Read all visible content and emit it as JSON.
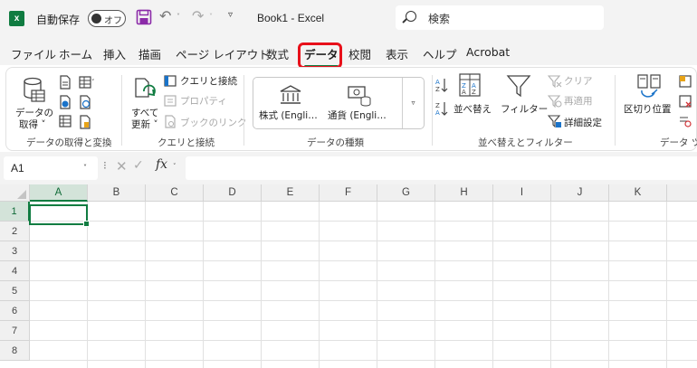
{
  "titlebar": {
    "logo": "x",
    "autosave_label": "自動保存",
    "autosave_state": "オフ",
    "doc_title": "Book1  -  Excel",
    "search_placeholder": "検索",
    "customize_glyph": "▿"
  },
  "tabs": [
    {
      "label": "ファイル"
    },
    {
      "label": "ホーム"
    },
    {
      "label": "挿入"
    },
    {
      "label": "描画"
    },
    {
      "label": "ページ レイアウト"
    },
    {
      "label": "数式"
    },
    {
      "label": "データ"
    },
    {
      "label": "校閲"
    },
    {
      "label": "表示"
    },
    {
      "label": "ヘルプ"
    },
    {
      "label": "Acrobat"
    }
  ],
  "active_tab": "データ",
  "ribbon": {
    "get_data": {
      "line1": "データの",
      "line2": "取得 ˅"
    },
    "get_group_label": "データの取得と変換",
    "refresh_all": {
      "line1": "すべて",
      "line2": "更新 ˅"
    },
    "queries_connections": "クエリと接続",
    "properties": "プロパティ",
    "workbook_links": "ブックのリンク",
    "queries_group_label": "クエリと接続",
    "stocks": "株式 (Engli…",
    "currencies": "通貨 (Engli…",
    "datatypes_group_label": "データの種類",
    "sort": "並べ替え",
    "filter": "フィルター",
    "clear": "クリア",
    "reapply": "再適用",
    "advanced": "詳細設定",
    "sort_filter_group_label": "並べ替えとフィルター",
    "text_to_columns": "区切り位置",
    "data_tools_group_label": "データ ツ"
  },
  "formula_bar": {
    "namebox": "A1",
    "fx": "fx"
  },
  "grid": {
    "columns": [
      "A",
      "B",
      "C",
      "D",
      "E",
      "F",
      "G",
      "H",
      "I",
      "J",
      "K"
    ],
    "rows": [
      "1",
      "2",
      "3",
      "4",
      "5",
      "6",
      "7",
      "8"
    ],
    "selected_cell": "A1"
  },
  "colors": {
    "excel_green": "#107c41",
    "highlight_red": "#e8101a"
  }
}
